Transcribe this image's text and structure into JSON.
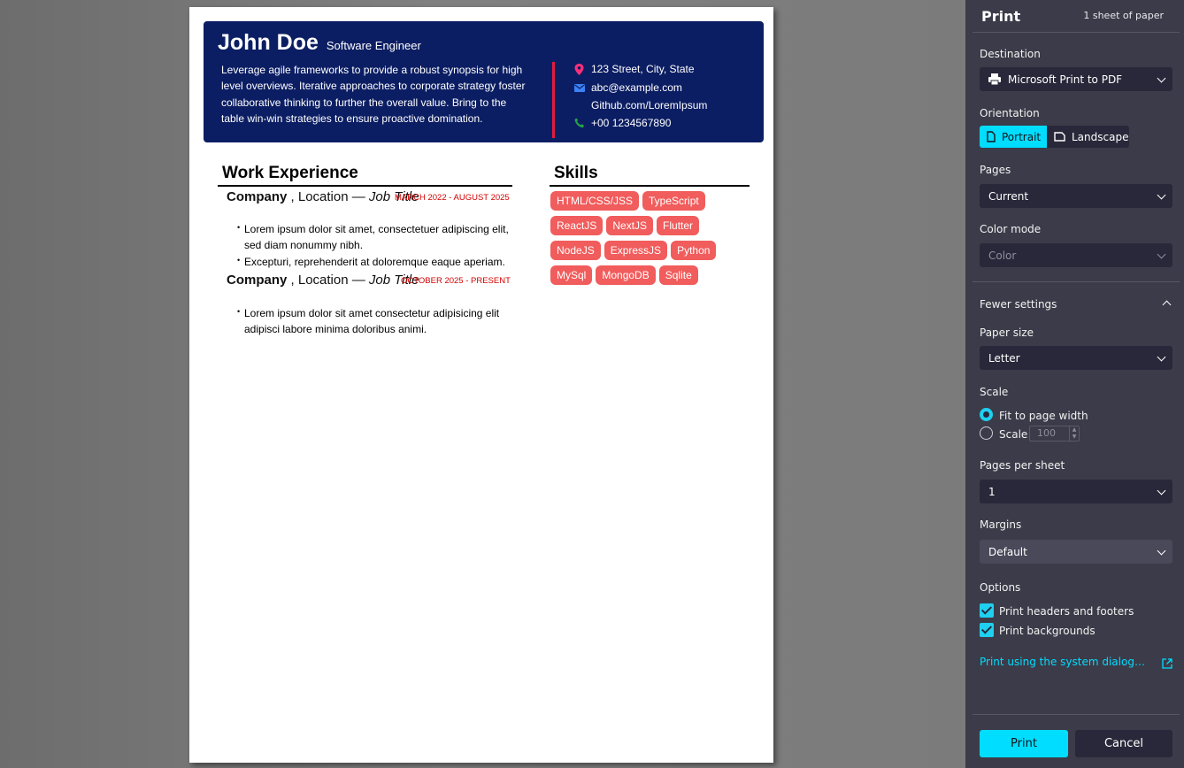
{
  "resume": {
    "name": "John Doe",
    "title": "Software Engineer",
    "summary": "Leverage agile frameworks to provide a robust synopsis for high level overviews. Iterative approaches to corporate strategy foster collaborative thinking to further the overall value. Bring to the table win-win strategies to ensure proactive domination.",
    "contact": {
      "address": "123 Street, City, State",
      "email": "abc@example.com",
      "github": "Github.com/LoremIpsum",
      "phone": "+00 1234567890"
    },
    "work_title": "Work Experience",
    "jobs": [
      {
        "company": "Company",
        "location": "Location",
        "sep": "—",
        "job_title": "Job Title",
        "dates": "MARCH 2022 - AUGUST 2025",
        "bullets": [
          "Lorem ipsum dolor sit amet, consectetuer adipiscing elit, sed diam nonummy nibh.",
          "Excepturi, reprehenderit at doloremque eaque aperiam."
        ]
      },
      {
        "company": "Company",
        "location": "Location",
        "sep": "—",
        "job_title": "Job Title",
        "dates": "OCTOBER 2025 - PRESENT",
        "bullets": [
          "Lorem ipsum dolor sit amet consectetur adipisicing elit adipisci labore minima doloribus animi."
        ]
      }
    ],
    "skills_title": "Skills",
    "skills": [
      "HTML/CSS/JSS",
      "TypeScript",
      "ReactJS",
      "NextJS",
      "Flutter",
      "NodeJS",
      "ExpressJS",
      "Python",
      "MySql",
      "MongoDB",
      "Sqlite"
    ]
  },
  "print_panel": {
    "title": "Print",
    "sheets": "1 sheet of paper",
    "destination_label": "Destination",
    "destination_value": "Microsoft Print to PDF",
    "orientation_label": "Orientation",
    "portrait": "Portrait",
    "landscape": "Landscape",
    "orientation_selected": "Portrait",
    "pages_label": "Pages",
    "pages_value": "Current",
    "color_mode_label": "Color mode",
    "color_mode_value": "Color",
    "fewer_settings": "Fewer settings",
    "paper_size_label": "Paper size",
    "paper_size_value": "Letter",
    "scale_label": "Scale",
    "fit_to_page_width": "Fit to page width",
    "scale_option": "Scale",
    "scale_value": "100",
    "pages_per_sheet_label": "Pages per sheet",
    "pages_per_sheet_value": "1",
    "margins_label": "Margins",
    "margins_value": "Default",
    "options_label": "Options",
    "print_headers_footers": "Print headers and footers",
    "print_backgrounds": "Print backgrounds",
    "system_dialog_link": "Print using the system dialog…",
    "print_button": "Print",
    "cancel_button": "Cancel"
  },
  "colors": {
    "resume_header_bg": "#0c1e63",
    "accent_red": "#e01e3c",
    "skill_chip": "#f15c5c",
    "panel_bg": "#3c3b49",
    "accent_cyan": "#00ddff"
  }
}
